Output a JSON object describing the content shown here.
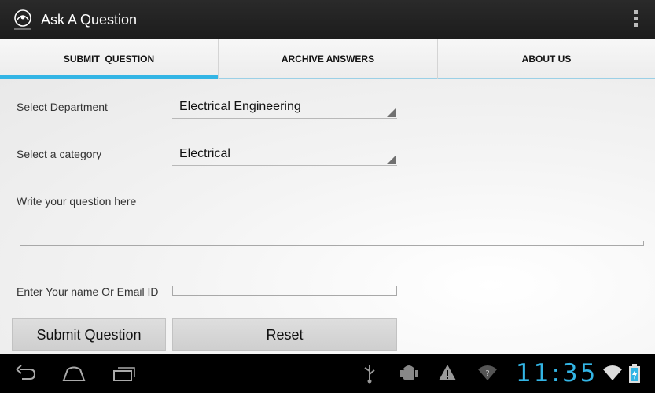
{
  "app": {
    "title": "Ask A Question",
    "logo_icon": "app-logo-icon",
    "overflow_icon": "overflow-menu-icon"
  },
  "tabs": [
    {
      "label": "SUBMIT  QUESTION",
      "active": true
    },
    {
      "label": "ARCHIVE ANSWERS",
      "active": false
    },
    {
      "label": "ABOUT US",
      "active": false
    }
  ],
  "form": {
    "department_label": "Select Department",
    "department_value": "Electrical Engineering",
    "category_label": "Select a category",
    "category_value": "Electrical",
    "question_label": "Write your question here",
    "question_value": "",
    "name_label": "Enter Your name Or Email ID",
    "name_value": ""
  },
  "buttons": {
    "submit": "Submit Question",
    "reset": "Reset"
  },
  "system_bar": {
    "time": "11:35",
    "accent_color": "#33b5e5",
    "nav_icons": [
      "back-icon",
      "home-icon",
      "recents-icon"
    ],
    "status_icons": [
      "usb-icon",
      "android-debug-icon",
      "warning-icon",
      "wifi-question-icon",
      "wifi-icon",
      "battery-icon"
    ]
  }
}
